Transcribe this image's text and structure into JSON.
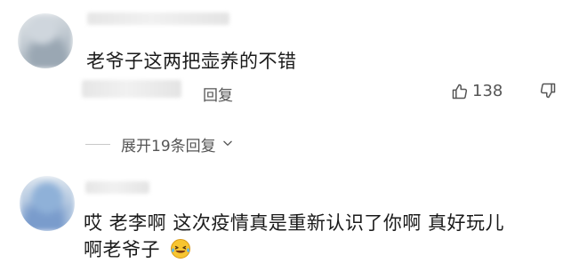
{
  "comments": [
    {
      "text": "老爷子这两把壶养的不错",
      "reply_label": "回复",
      "like_count": "138",
      "expand_label": "展开19条回复"
    },
    {
      "text_line1": "哎 老李啊 这次疫情真是重新认识了你啊 真好玩儿",
      "text_line2": "啊老爷子"
    }
  ],
  "icons": {
    "like": "thumbs-up-icon",
    "dislike": "thumbs-down-icon",
    "expand": "chevron-down-icon",
    "emoji": "laughing-crying-emoji"
  },
  "colors": {
    "text": "#1a1a1a",
    "secondary": "#555555"
  }
}
